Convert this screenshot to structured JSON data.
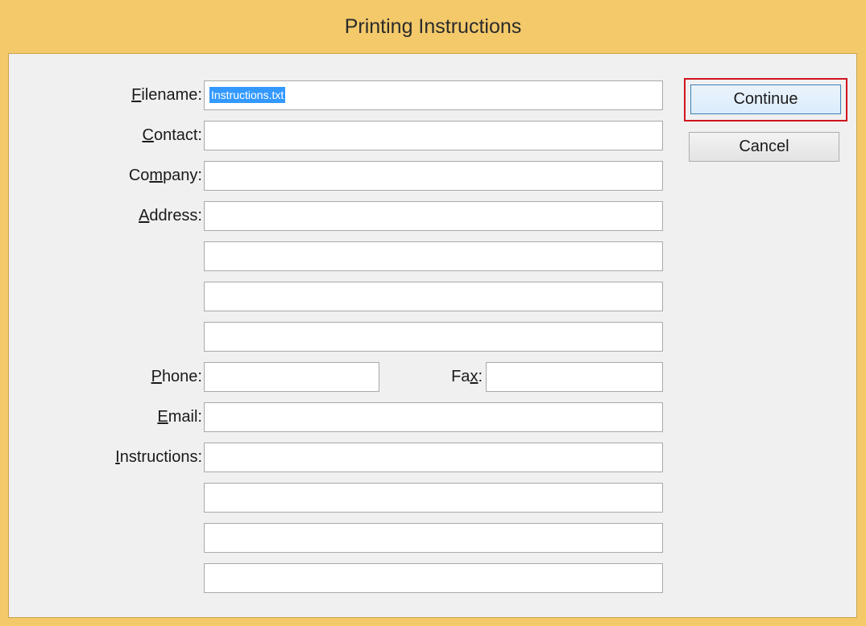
{
  "window": {
    "title": "Printing Instructions"
  },
  "form": {
    "filename": {
      "label_mn": "F",
      "label_rest": "ilename:",
      "value": "Instructions.txt"
    },
    "contact": {
      "label_mn": "C",
      "label_rest": "ontact:",
      "value": ""
    },
    "company": {
      "label_pre": "Co",
      "label_mn": "m",
      "label_rest": "pany:",
      "value": ""
    },
    "address": {
      "label_mn": "A",
      "label_rest": "ddress:",
      "lines": [
        "",
        "",
        "",
        ""
      ]
    },
    "phone": {
      "label_mn": "P",
      "label_rest": "hone:",
      "value": ""
    },
    "fax": {
      "label_pre": "Fa",
      "label_mn": "x",
      "label_rest": ":",
      "value": ""
    },
    "email": {
      "label_mn": "E",
      "label_rest": "mail:",
      "value": ""
    },
    "instructions": {
      "label_mn": "I",
      "label_rest": "nstructions:",
      "lines": [
        "",
        "",
        "",
        ""
      ]
    }
  },
  "buttons": {
    "continue_label": "Continue",
    "cancel_label": "Cancel"
  },
  "colors": {
    "title_bar": "#f3c96a",
    "client": "#f0f0f0",
    "selection": "#3399ff",
    "focus_highlight": "#d0141d"
  }
}
